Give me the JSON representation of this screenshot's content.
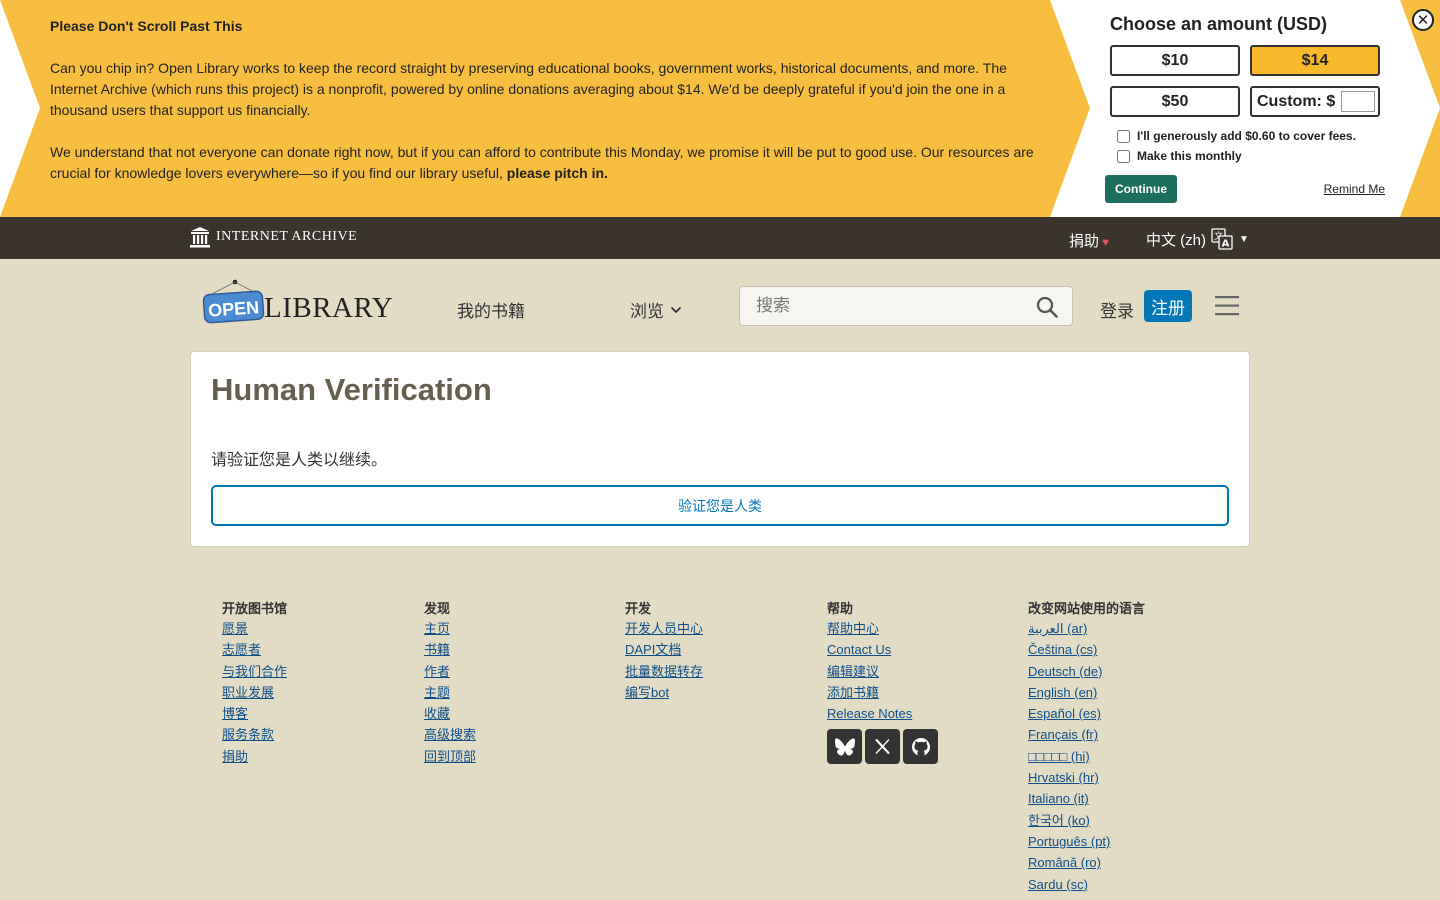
{
  "banner": {
    "title": "Please Don't Scroll Past This",
    "para1": "Can you chip in? Open Library works to keep the record straight by preserving educational books, government works, historical documents, and more. The Internet Archive (which runs this project) is a nonprofit, powered by online donations averaging about $14. We'd be deeply grateful if you'd join the one in a thousand users that support us financially.",
    "para2_main": "We understand that not everyone can donate right now, but if you can afford to contribute this Monday, we promise it will be put to good use. Our resources are crucial for knowledge lovers everywhere—so if you find our library useful, ",
    "para2_bold": "please pitch in.",
    "close_symbol": "✕",
    "choose_title": "Choose an amount (USD)",
    "amounts": [
      "$10",
      "$14",
      "$50"
    ],
    "selected_amount": "$14",
    "custom_label": "Custom: $",
    "cover_fees_label": "I'll generously add $0.60 to cover fees.",
    "monthly_label": "Make this monthly",
    "continue_label": "Continue",
    "remind_label": "Remind Me",
    "bg_color": "#f8be3f",
    "accent_color": "#1c6e5d"
  },
  "ia_bar": {
    "logo_text": "INTERNET ARCHIVE",
    "donate_label": "捐助",
    "heart": "♥",
    "language_label": "中文 (zh)",
    "language_caret": "▼"
  },
  "header": {
    "logo_open": "OPEN",
    "logo_library": "LIBRARY",
    "my_books": "我的书籍",
    "browse": "浏览",
    "search_placeholder": "搜索",
    "login": "登录",
    "signup": "注册"
  },
  "main": {
    "title": "Human Verification",
    "message": "请验证您是人类以继续。",
    "verify_button": "验证您是人类"
  },
  "footer": {
    "columns": [
      {
        "heading": "开放图书馆",
        "links": [
          "愿景",
          "志愿者",
          "与我们合作",
          "职业发展",
          "博客",
          "服务条款",
          "捐助"
        ]
      },
      {
        "heading": "发现",
        "links": [
          "主页",
          "书籍",
          "作者",
          "主题",
          "收藏",
          "高级搜索",
          "回到顶部"
        ]
      },
      {
        "heading": "开发",
        "links": [
          "开发人员中心",
          "DAPI文档",
          "批量数据转存",
          "编写bot"
        ]
      },
      {
        "heading": "帮助",
        "links": [
          "帮助中心",
          "Contact Us",
          "编辑建议",
          "添加书籍",
          "Release Notes"
        ]
      },
      {
        "heading": "改变网站使用的语言",
        "links": [
          "العربية (ar)",
          "Čeština (cs)",
          "Deutsch (de)",
          "English (en)",
          "Español (es)",
          "Français (fr)",
          "□□□□□ (hi)",
          "Hrvatski (hr)",
          "Italiano (it)",
          "한국어 (ko)",
          "Português (pt)",
          "Română (ro)",
          "Sardu (sc)"
        ]
      }
    ],
    "social_icons": [
      "bluesky-icon",
      "x-twitter-icon",
      "github-icon"
    ]
  }
}
